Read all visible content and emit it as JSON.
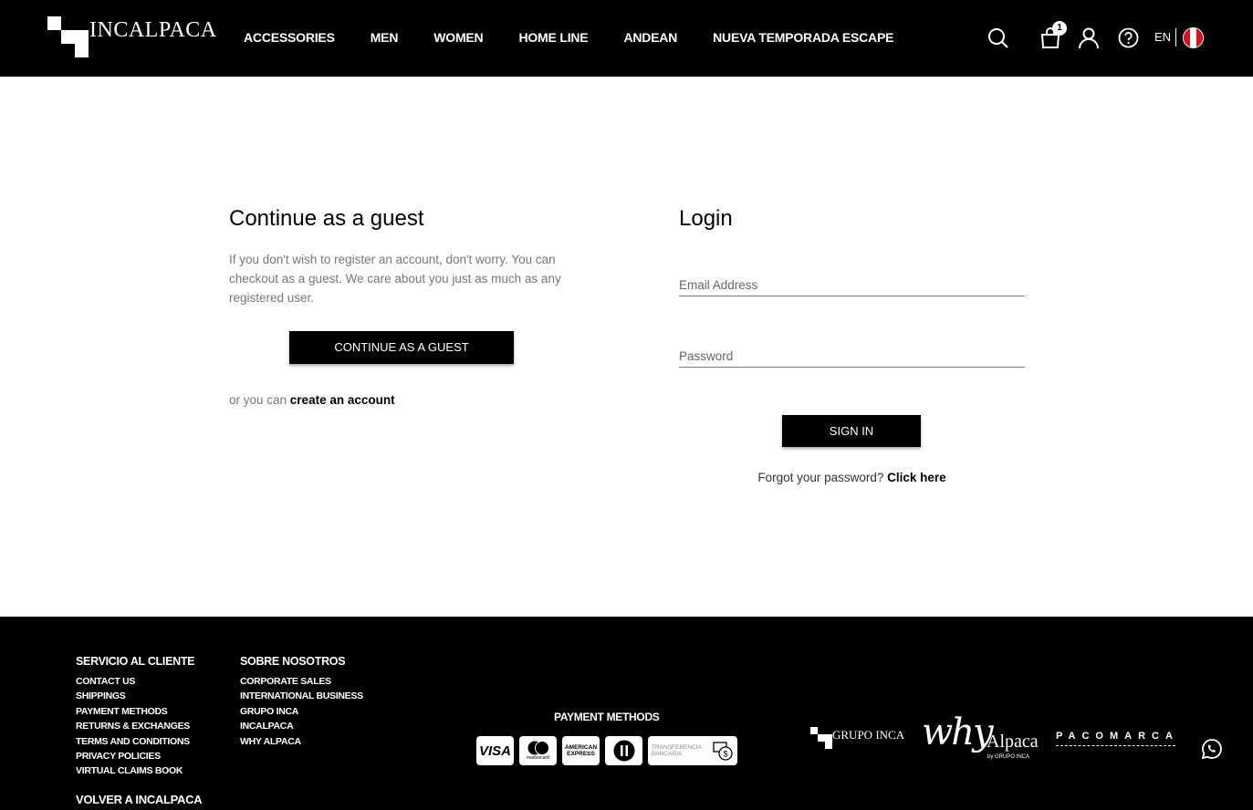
{
  "header": {
    "logo_text": "INCALPACA",
    "nav": [
      "ACCESSORIES",
      "MEN",
      "WOMEN",
      "HOME LINE",
      "ANDEAN",
      "NUEVA TEMPORADA ESCAPE"
    ],
    "cart_count": "1",
    "language": "EN",
    "flag_colors": [
      "#d91023",
      "#ffffff",
      "#d91023"
    ]
  },
  "guest": {
    "title": "Continue as a guest",
    "description": "If you don't wish to register an account, don't worry. You can checkout as a guest. We care about you just as much as any registered user.",
    "button_label": "CONTINUE AS A GUEST",
    "create_prefix": "or you can ",
    "create_link": "create an account"
  },
  "login": {
    "title": "Login",
    "email_placeholder": "Email Address",
    "password_placeholder": "Password",
    "signin_label": "SIGN IN",
    "forgot_prefix": "Forgot your password? ",
    "forgot_link": "Click here"
  },
  "footer": {
    "col1": {
      "title": "SERVICIO AL CLIENTE",
      "links": [
        "CONTACT US",
        "SHIPPINGS",
        "PAYMENT METHODS",
        "RETURNS & EXCHANGES",
        "TERMS AND CONDITIONS",
        "PRIVACY POLICIES",
        "VIRTUAL CLAIMS BOOK"
      ]
    },
    "col2": {
      "title": "SOBRE NOSOTROS",
      "links": [
        "CORPORATE SALES",
        "INTERNATIONAL BUSINESS",
        "GRUPO INCA",
        "INCALPACA",
        "WHY ALPACA"
      ]
    },
    "back_link": "VOLVER A INCALPACA",
    "payment_title": "PAYMENT METHODS",
    "payment_cards": [
      "VISA",
      "mastercard",
      "AMERICAN EXPRESS",
      "Diners",
      "TRANSFERENCIA BANCARIA"
    ],
    "brands": {
      "grupo_inca": "GRUPO INCA",
      "why": "why",
      "alpaca": "Alpaca",
      "by": "by GRUPO INCA",
      "pacomarca": "PACOMARCA"
    }
  }
}
